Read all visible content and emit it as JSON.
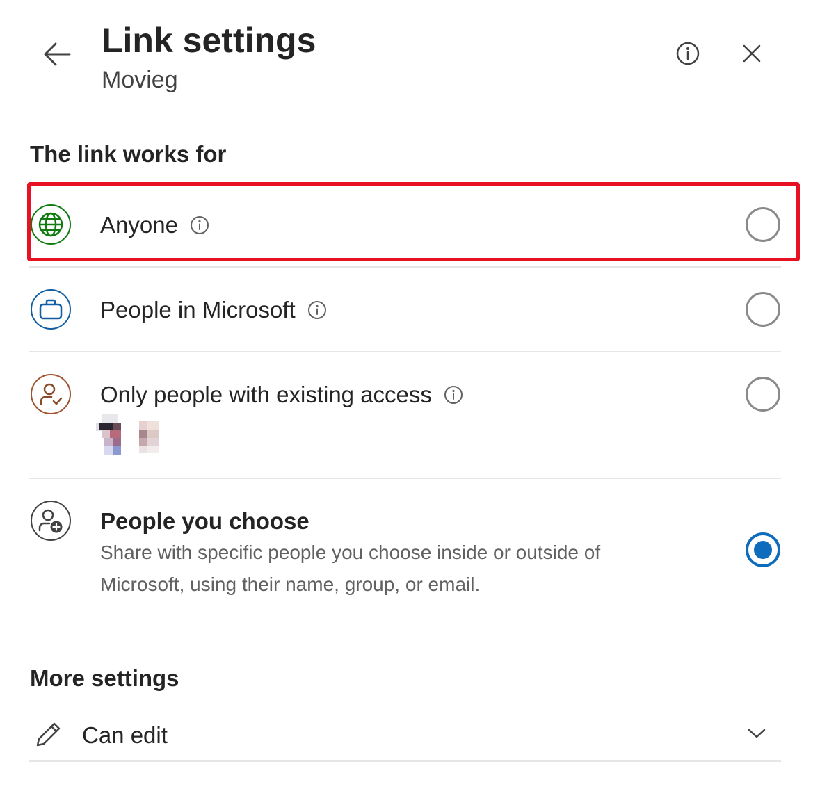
{
  "header": {
    "title": "Link settings",
    "subtitle": "Movieg"
  },
  "link_works_for": {
    "heading": "The link works for",
    "options": [
      {
        "label": "Anyone",
        "selected": false,
        "icon": "globe-icon",
        "color": "#107c10"
      },
      {
        "label": "People in Microsoft",
        "selected": false,
        "icon": "briefcase-icon",
        "color": "#115ea3"
      },
      {
        "label": "Only people with existing access",
        "selected": false,
        "icon": "person-check-icon",
        "color": "#a0522d"
      },
      {
        "label": "People you choose",
        "description": "Share with specific people you choose inside or outside of Microsoft, using their name, group, or email.",
        "selected": true,
        "icon": "person-add-icon",
        "color": "#424242"
      }
    ]
  },
  "more_settings": {
    "heading": "More settings",
    "permission": "Can edit"
  },
  "colors": {
    "accent": "#0f6cbd",
    "highlight": "#e81123",
    "divider": "#e6e6e6"
  }
}
